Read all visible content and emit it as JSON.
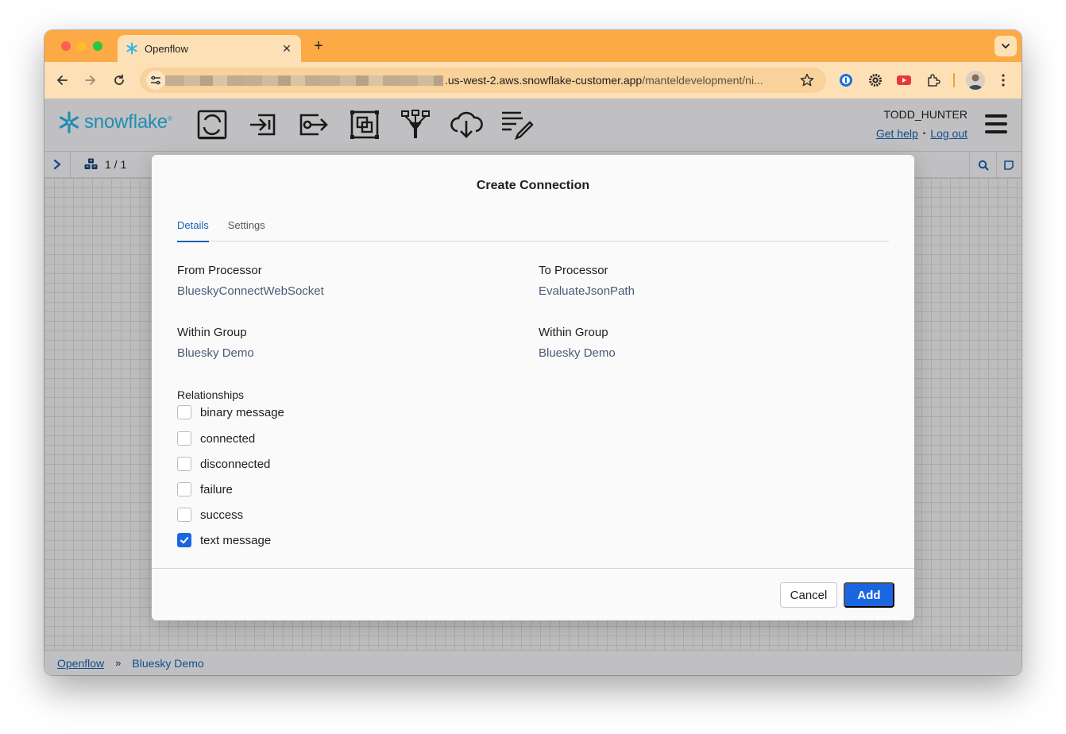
{
  "browser": {
    "tab_title": "Openflow",
    "url_visible": ".us-west-2.aws.snowflake-customer.app",
    "url_path": "/manteldevelopment/ni..."
  },
  "header": {
    "logo_text": "snowflake",
    "logo_mark": "®",
    "user_name": "TODD_HUNTER",
    "get_help": "Get help",
    "separator": "•",
    "log_out": "Log out",
    "tools": [
      "processor-icon",
      "input-port-icon",
      "output-port-icon",
      "process-group-icon",
      "funnel-icon",
      "remote-process-group-icon",
      "label-icon"
    ]
  },
  "nav_strip": {
    "count": "1 / 1"
  },
  "dialog": {
    "title": "Create Connection",
    "tabs": [
      {
        "label": "Details",
        "active": true
      },
      {
        "label": "Settings",
        "active": false
      }
    ],
    "from_processor_label": "From Processor",
    "from_processor_value": "BlueskyConnectWebSocket",
    "to_processor_label": "To Processor",
    "to_processor_value": "EvaluateJsonPath",
    "from_group_label": "Within Group",
    "from_group_value": "Bluesky Demo",
    "to_group_label": "Within Group",
    "to_group_value": "Bluesky Demo",
    "relationships_label": "Relationships",
    "relationships": [
      {
        "label": "binary message",
        "checked": false
      },
      {
        "label": "connected",
        "checked": false
      },
      {
        "label": "disconnected",
        "checked": false
      },
      {
        "label": "failure",
        "checked": false
      },
      {
        "label": "success",
        "checked": false
      },
      {
        "label": "text message",
        "checked": true
      }
    ],
    "cancel_label": "Cancel",
    "add_label": "Add"
  },
  "breadcrumb": {
    "root": "Openflow",
    "separator": "»",
    "current": "Bluesky Demo"
  },
  "colors": {
    "tab_bar": "#fcaa45",
    "toolbar": "#fee0b6",
    "accent": "#1a66e0",
    "link": "#1a5fb4",
    "snowflake_blue": "#29b5e8"
  }
}
